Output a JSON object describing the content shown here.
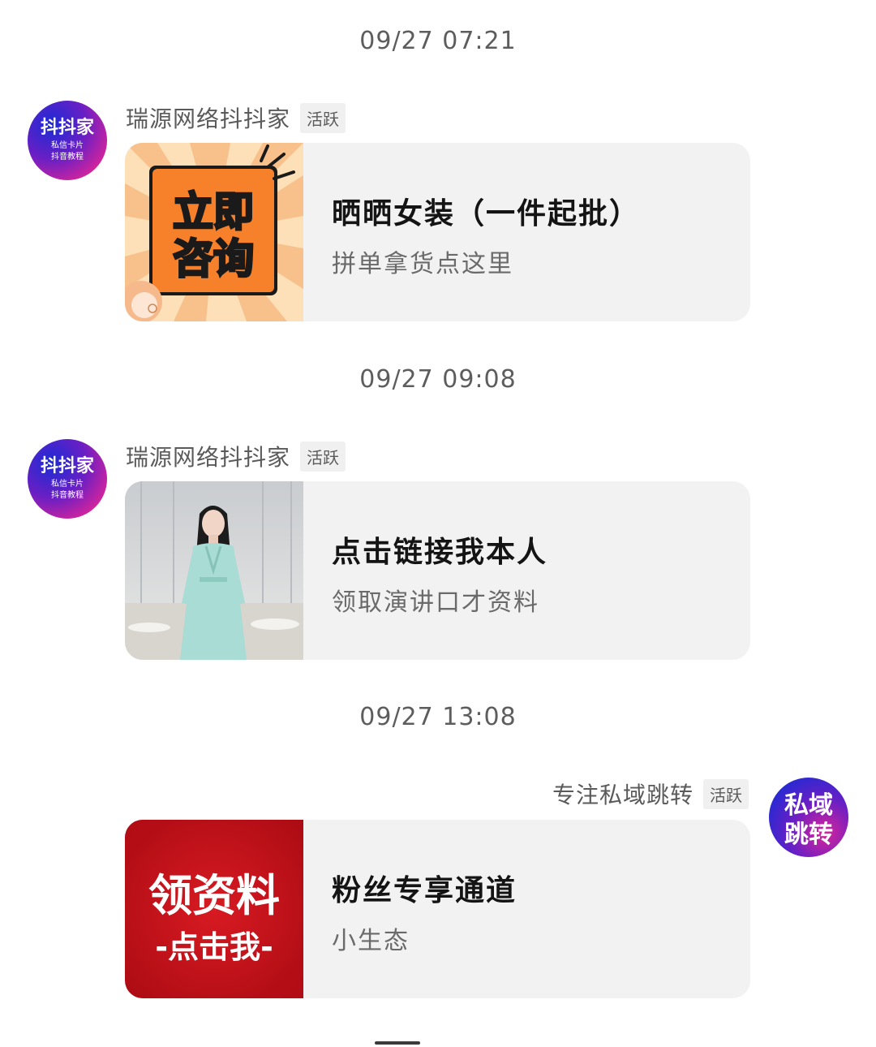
{
  "messages": [
    {
      "timestamp": "09/27 07:21",
      "sender": "瑞源网络抖抖家",
      "badge": "活跃",
      "avatar": {
        "line1": "抖抖家",
        "line2": "私信卡片",
        "line3": "抖音教程"
      },
      "card": {
        "title": "晒晒女装（一件起批）",
        "subtitle": "拼单拿货点这里",
        "thumb_text": [
          "立即",
          "咨询"
        ]
      }
    },
    {
      "timestamp": "09/27 09:08",
      "sender": "瑞源网络抖抖家",
      "badge": "活跃",
      "avatar": {
        "line1": "抖抖家",
        "line2": "私信卡片",
        "line3": "抖音教程"
      },
      "card": {
        "title": "点击链接我本人",
        "subtitle": "领取演讲口才资料"
      }
    },
    {
      "timestamp": "09/27 13:08",
      "sender": "专注私域跳转",
      "badge": "活跃",
      "avatar": {
        "line1": "私域",
        "line2": "跳转"
      },
      "card": {
        "title": "粉丝专享通道",
        "subtitle": "小生态",
        "thumb_text": [
          "领资料",
          "-点击我-"
        ]
      }
    }
  ],
  "colors": {
    "avatar_gradient_start": "#1b2bd6",
    "avatar_gradient_end": "#d8249a",
    "consult_orange": "#f7812a",
    "red_banner": "#c8101b"
  }
}
